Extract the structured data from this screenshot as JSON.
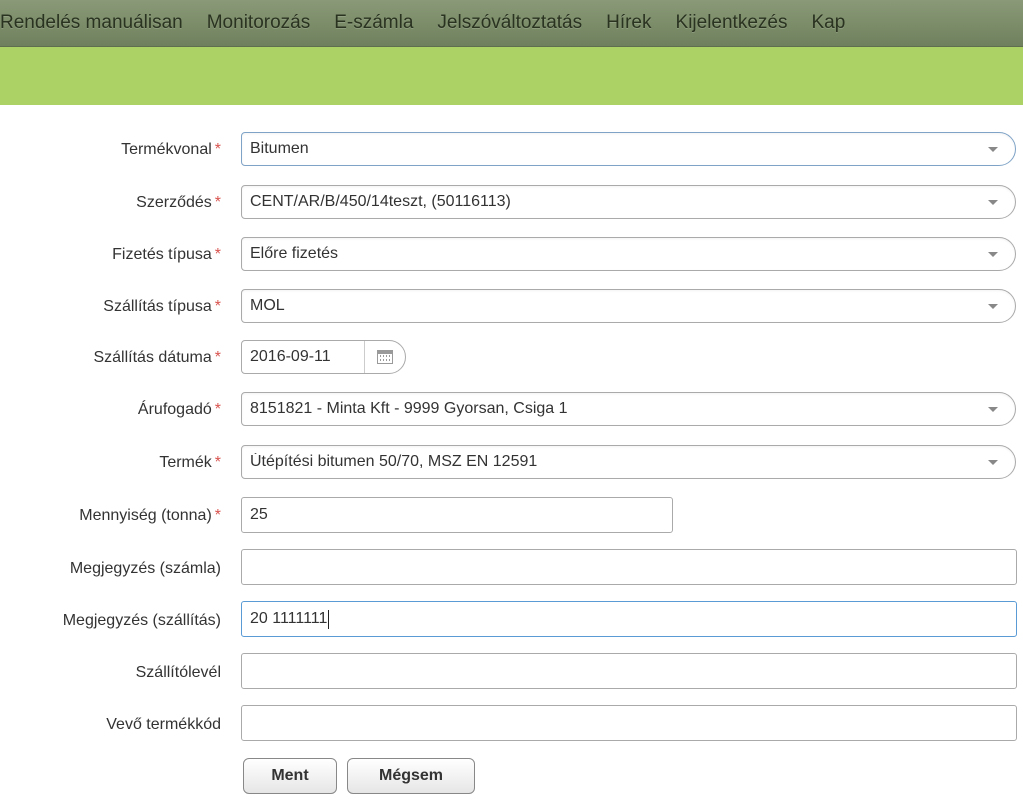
{
  "nav": {
    "items": [
      "Rendelés manuálisan",
      "Monitorozás",
      "E-számla",
      "Jelszóváltoztatás",
      "Hírek",
      "Kijelentkezés",
      "Kap"
    ]
  },
  "form": {
    "required_mark": "*",
    "product_line": {
      "label": "Termékvonal",
      "value": "Bitumen"
    },
    "contract": {
      "label": "Szerződés",
      "value": "CENT/AR/B/450/14teszt, (50116113)"
    },
    "payment_type": {
      "label": "Fizetés típusa",
      "value": "Előre fizetés"
    },
    "delivery_type": {
      "label": "Szállítás típusa",
      "value": "MOL"
    },
    "delivery_date": {
      "label": "Szállítás dátuma",
      "value": "2016-09-11"
    },
    "consignee": {
      "label": "Árufogadó",
      "value": "8151821 - Minta Kft - 9999 Gyorsan, Csiga 1"
    },
    "product": {
      "label": "Termék",
      "value": "Útépítési bitumen 50/70, MSZ EN 12591"
    },
    "quantity": {
      "label": "Mennyiség (tonna)",
      "value": "25"
    },
    "note_invoice": {
      "label": "Megjegyzés (számla)",
      "value": ""
    },
    "note_delivery": {
      "label": "Megjegyzés (szállítás)",
      "value": "20 1111111"
    },
    "delivery_note": {
      "label": "Szállítólevél",
      "value": ""
    },
    "customer_code": {
      "label": "Vevő termékkód",
      "value": ""
    }
  },
  "buttons": {
    "save": "Ment",
    "cancel": "Mégsem"
  }
}
